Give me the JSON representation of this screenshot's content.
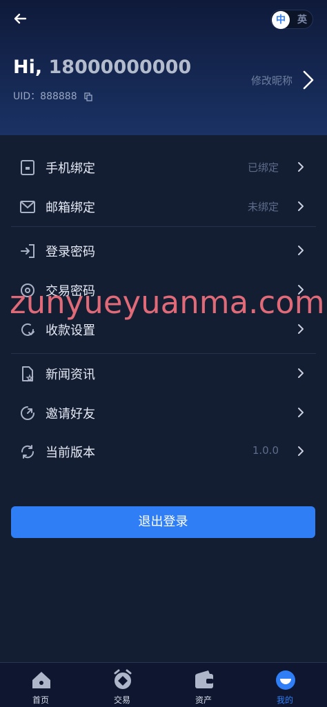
{
  "header": {
    "greeting": "Hi,",
    "phone": "18000000000",
    "uid_label": "UID：",
    "uid_value": "888888",
    "edit_nickname": "修改昵称",
    "back_icon": "arrow-left-icon",
    "copy_icon": "copy-icon"
  },
  "language_toggle": {
    "active": "中",
    "inactive": "英"
  },
  "menu": {
    "phone_binding": {
      "label": "手机绑定",
      "value": "已绑定",
      "icon": "phone-icon"
    },
    "email_binding": {
      "label": "邮箱绑定",
      "value": "未绑定",
      "icon": "mail-icon"
    },
    "login_password": {
      "label": "登录密码",
      "icon": "login-icon"
    },
    "trade_password": {
      "label": "交易密码",
      "icon": "lock-icon"
    },
    "payment_settings": {
      "label": "收款设置",
      "icon": "refresh-icon"
    },
    "news": {
      "label": "新闻资讯",
      "icon": "document-icon"
    },
    "invite": {
      "label": "邀请好友",
      "icon": "invite-icon"
    },
    "version": {
      "label": "当前版本",
      "value": "1.0.0",
      "icon": "sync-icon"
    }
  },
  "logout_button": "退出登录",
  "watermark": "zunyueyuanma.com",
  "tabbar": {
    "home": "首页",
    "trade": "交易",
    "assets": "资产",
    "mine": "我的",
    "active": "mine"
  },
  "colors": {
    "background": "#141e33",
    "accent": "#2f7ef5",
    "header_gradient_top": "#0f1a3a",
    "header_gradient_bottom": "#1a3264"
  }
}
